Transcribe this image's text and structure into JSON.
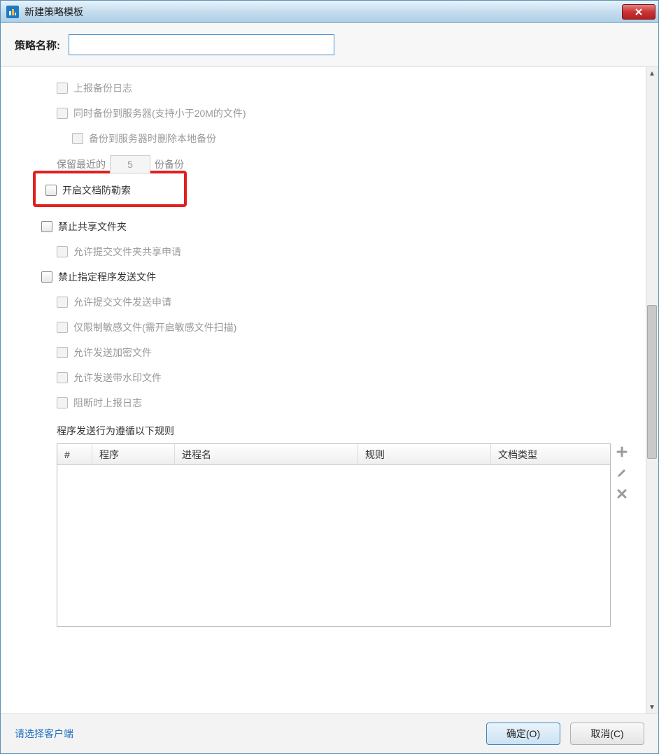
{
  "window": {
    "title": "新建策略模板"
  },
  "header": {
    "label": "策略名称:",
    "value": ""
  },
  "options": {
    "report_backup_log": "上报备份日志",
    "backup_to_server": "同时备份到服务器(支持小于20M的文件)",
    "delete_local_on_server_backup": "备份到服务器时删除本地备份",
    "keep_recent_prefix": "保留最近的",
    "keep_recent_value": "5",
    "keep_recent_suffix": "份备份",
    "enable_doc_anti_ransom": "开启文档防勒索",
    "forbid_share_folder": "禁止共享文件夹",
    "allow_share_request": "允许提交文件夹共享申请",
    "forbid_program_send": "禁止指定程序发送文件",
    "allow_send_request": "允许提交文件发送申请",
    "restrict_sensitive_only": "仅限制敏感文件(需开启敏感文件扫描)",
    "allow_send_encrypted": "允许发送加密文件",
    "allow_send_watermark": "允许发送带水印文件",
    "report_on_block": "阻断时上报日志",
    "rules_label": "程序发送行为遵循以下规则"
  },
  "table": {
    "cols": {
      "index": "#",
      "program": "程序",
      "process": "进程名",
      "rule": "规则",
      "doctype": "文档类型"
    },
    "rows": []
  },
  "footer": {
    "select_client": "请选择客户端",
    "ok": "确定(O)",
    "cancel": "取消(C)"
  }
}
